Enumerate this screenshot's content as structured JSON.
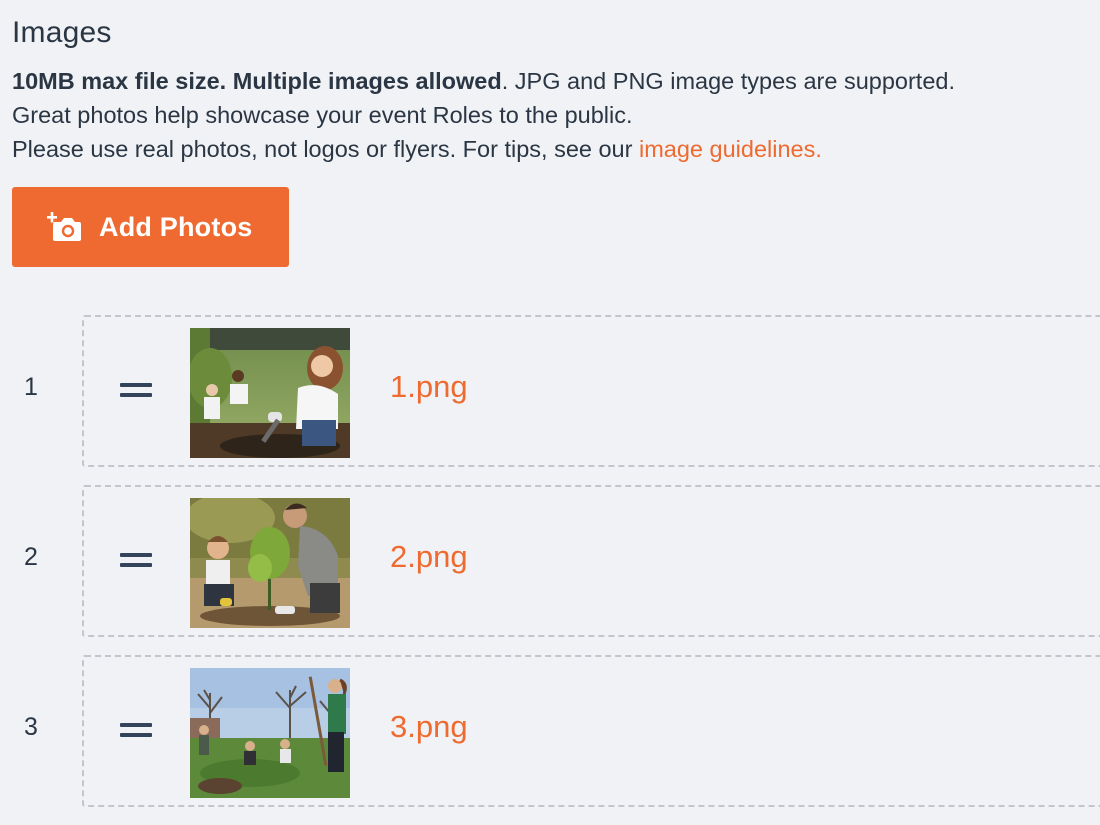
{
  "section": {
    "title": "Images",
    "desc_bold": "10MB max file size. Multiple images allowed",
    "desc_rest": ". JPG and PNG image types are supported.",
    "line2": "Great photos help showcase your event Roles to the public.",
    "line3_prefix": "Please use real photos, not logos or flyers. For tips, see our ",
    "guidelines_link": "image guidelines."
  },
  "add_button": {
    "label": "Add Photos",
    "icon": "camera-plus-icon"
  },
  "images": [
    {
      "index": "1",
      "filename": "1.png"
    },
    {
      "index": "2",
      "filename": "2.png"
    },
    {
      "index": "3",
      "filename": "3.png"
    }
  ],
  "colors": {
    "accent": "#ee6a30",
    "text": "#2b3644",
    "background": "#f0f2f5",
    "border": "#c2c6cc"
  }
}
